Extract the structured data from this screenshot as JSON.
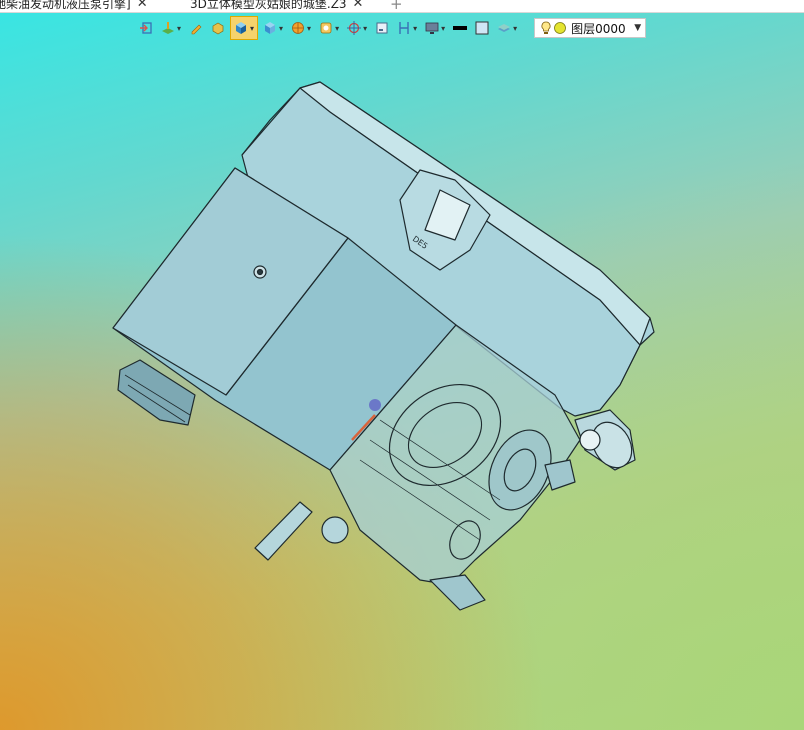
{
  "tabs": [
    {
      "label": "驰柴油发动机液压泵引擎]",
      "close": "✕",
      "active": true
    },
    {
      "label": "3D立体模型灰姑娘的城堡.Z3",
      "close": "✕",
      "active": false
    }
  ],
  "new_tab_symbol": "+",
  "toolbar": {
    "tools": [
      {
        "icon": "exit-icon"
      },
      {
        "icon": "plane-view-icon",
        "dropdown": true
      },
      {
        "icon": "pencil-icon"
      },
      {
        "icon": "cube-edit-icon"
      },
      {
        "icon": "cube-shaded-icon",
        "dropdown": true,
        "selected": true
      },
      {
        "icon": "cube-display-icon",
        "dropdown": true
      },
      {
        "icon": "render-ball-icon",
        "dropdown": true
      },
      {
        "icon": "filter-icon",
        "dropdown": true
      },
      {
        "icon": "snap-target-icon",
        "dropdown": true
      },
      {
        "icon": "frame-icon"
      },
      {
        "icon": "measure-icon",
        "dropdown": true
      },
      {
        "icon": "monitor-icon",
        "dropdown": true
      },
      {
        "icon": "line-color-icon"
      },
      {
        "icon": "fill-color-icon"
      },
      {
        "icon": "layers-icon",
        "dropdown": true
      }
    ],
    "layer_select": {
      "value": "图层0000",
      "icons": [
        "lightbulb-icon",
        "layer-color-icon"
      ]
    }
  },
  "model": {
    "description_icon": "engine-model-icon",
    "colors": {
      "shell": "#9ccdd6",
      "shell_dark": "#5f8f9a",
      "edge": "#1e2a2e"
    }
  }
}
